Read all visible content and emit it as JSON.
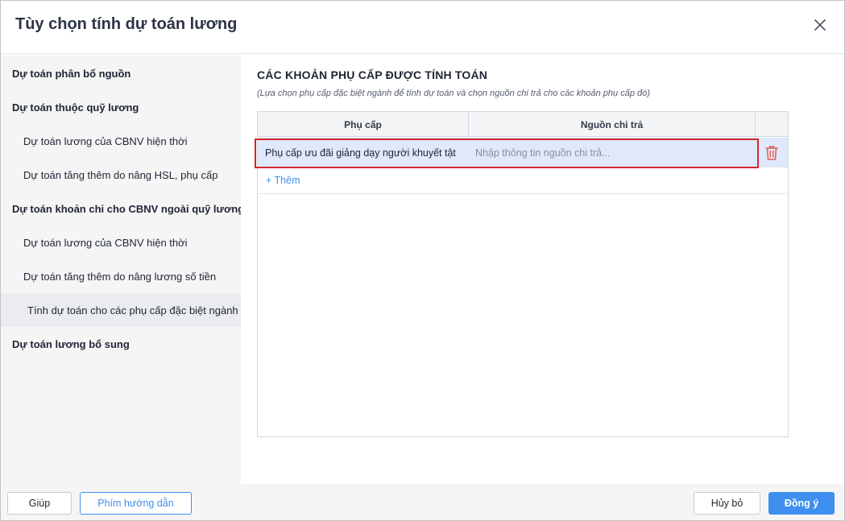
{
  "dialog": {
    "title": "Tùy chọn tính dự toán lương"
  },
  "sidebar": {
    "items": [
      {
        "label": "Dự toán phân bổ nguồn"
      },
      {
        "label": "Dự toán thuộc quỹ lương"
      },
      {
        "label": "Dự toán lương của CBNV hiện thời"
      },
      {
        "label": "Dự toán tăng thêm do nâng HSL, phụ cấp"
      },
      {
        "label": "Dự toán khoản chi cho CBNV ngoài quỹ lương"
      },
      {
        "label": "Dự toán lương của CBNV hiện thời"
      },
      {
        "label": "Dự toán tăng thêm do nâng lương số tiền"
      },
      {
        "label": "Tính dự toán cho các phụ cấp đặc biệt ngành"
      },
      {
        "label": "Dự toán lương bổ sung"
      }
    ]
  },
  "main": {
    "section_title": "CÁC KHOẢN PHỤ CẤP ĐƯỢC TÍNH TOÁN",
    "section_desc": "(Lựa chọn phụ cấp đặc biệt ngành để tính dự toán và chọn nguồn chi trả cho các khoản phụ cấp đó)",
    "table": {
      "columns": [
        "Phụ cấp",
        "Nguồn chi trả"
      ],
      "rows": [
        {
          "allowance": "Phụ cấp ưu đãi giảng dạy người khuyết tật",
          "source_value": "",
          "source_placeholder": "Nhập thông tin nguồn chi trả..."
        }
      ],
      "add_label": "+ Thêm"
    }
  },
  "footer": {
    "help_label": "Giúp",
    "guide_label": "Phím hướng dẫn",
    "cancel_label": "Hủy bỏ",
    "ok_label": "Đồng ý"
  },
  "colors": {
    "accent": "#3e8ff0",
    "highlight_border": "#d3282f",
    "selected_row": "#dfe9fb",
    "delete_icon": "#e05a4f"
  },
  "icons": {
    "close": "close-icon",
    "delete": "trash-icon"
  }
}
